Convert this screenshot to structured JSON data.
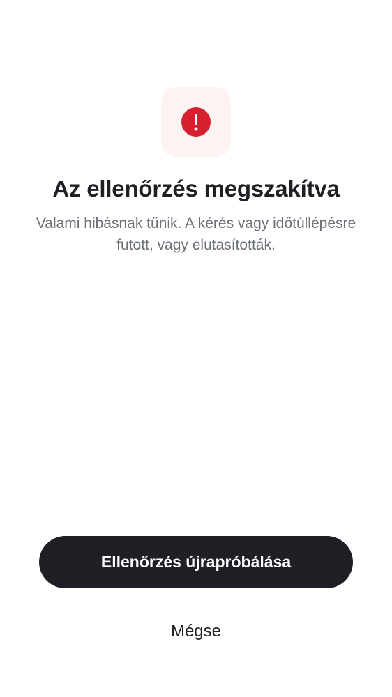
{
  "status_icon": {
    "name": "alert-circle-icon",
    "color": "#d6202f",
    "background": "#fdf3f2"
  },
  "title": "Az ellenőrzés megszakítva",
  "message": "Valami hibásnak tűnik. A kérés vagy időtúllépésre futott, vagy elutasították.",
  "actions": {
    "retry_label": "Ellenőrzés újrapróbálása",
    "cancel_label": "Mégse"
  },
  "colors": {
    "primary_button": "#1f2026",
    "text_muted": "#6b7078"
  }
}
